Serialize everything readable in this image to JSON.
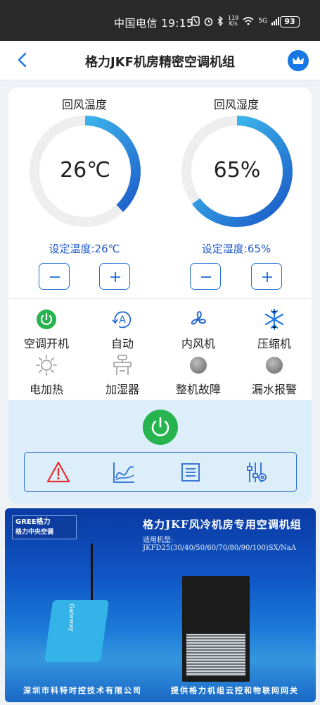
{
  "status_bar": {
    "carrier_time": "中国电信 19:15",
    "net_speed_value": "119",
    "net_speed_unit": "K/s",
    "signal": "5G",
    "battery": "93"
  },
  "navbar": {
    "title": "格力JKF机房精密空调机组"
  },
  "temperature": {
    "label": "回风温度",
    "value": "26℃",
    "percent": 0.38,
    "setpoint": "设定温度:26℃"
  },
  "humidity": {
    "label": "回风湿度",
    "value": "65%",
    "percent": 0.65,
    "setpoint": "设定湿度:65%"
  },
  "devices": [
    {
      "label": "空调开机",
      "icon": "power-on-icon",
      "color": "#27b34e"
    },
    {
      "label": "自动",
      "icon": "auto-mode-icon",
      "color": "#2a6bd1"
    },
    {
      "label": "内风机",
      "icon": "fan-icon",
      "color": "#2a6bd1"
    },
    {
      "label": "压缩机",
      "icon": "snowflake-icon",
      "color": "#1f7ae0"
    },
    {
      "label": "电加热",
      "icon": "heater-icon",
      "color": "#9a9a9a"
    },
    {
      "label": "加湿器",
      "icon": "humidifier-icon",
      "color": "#9a9a9a"
    },
    {
      "label": "整机故障",
      "icon": "fault-indicator-icon",
      "color": "#9a9a9a"
    },
    {
      "label": "漏水报警",
      "icon": "leak-indicator-icon",
      "color": "#9a9a9a"
    }
  ],
  "toolbar": {
    "items": [
      "alarm-icon",
      "trend-chart-icon",
      "log-list-icon",
      "settings-sliders-icon"
    ]
  },
  "colors": {
    "accent": "#1a56c7",
    "power": "#27b34e",
    "gauge_start": "#1a56c7",
    "gauge_end": "#46d3f5"
  },
  "banner": {
    "logo_line1": "GREE格力",
    "logo_line2": "格力中央空调",
    "title": "格力JKF风冷机房专用空调机组",
    "subtitle": "适用机型: JKFD25(30/40/50/60/70/80/90/100)SX/NaA",
    "gateway_label": "Gateway",
    "left_footer": "深圳市科特时控技术有限公司",
    "right_footer": "提供格力机组云控和物联网网关"
  }
}
